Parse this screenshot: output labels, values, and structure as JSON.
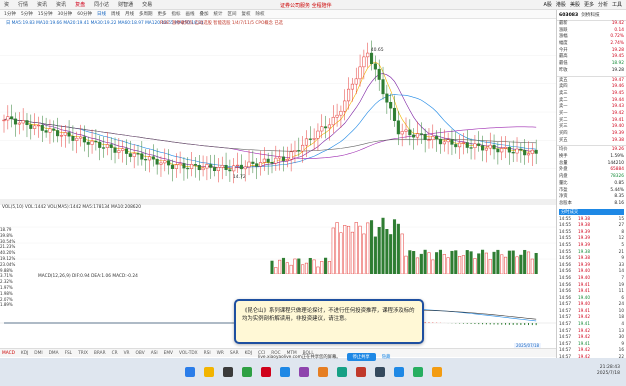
{
  "menu": {
    "items": [
      "资",
      "行情",
      "资讯",
      "资讯",
      "复盘",
      "同小达",
      "财智通",
      "交易"
    ],
    "active": 4,
    "title": "证券公司服务 全程陪伴",
    "right": [
      "A股",
      "港股",
      "美股",
      "更多",
      "分析",
      "工具"
    ]
  },
  "toolbar": {
    "items": [
      "1分钟",
      "5分钟",
      "15分钟",
      "30分钟",
      "60分钟",
      "日线",
      "周线",
      "月线",
      "多周期",
      "更多",
      "指标",
      "画线",
      "叠加",
      "统计",
      "区间",
      "复权",
      "除权"
    ],
    "active": 5
  },
  "ma_info": "日 MA5:19.83 MA10:19.66 MA20:19.41 MA30:19.22 MA60:18.97 MA120:18.55 MA250:18.31",
  "ma_info2": "ROE: 涨停敢死队 自动选股 智能选股 1/4/7/11/5 CPO概念 已选",
  "chart_peak_label": "40.65",
  "chart_low_label": "14.72",
  "vol_label": "VOL(5,10) VOL:1442 VOL(MA5):1442 MA5:178134 MA10:208620",
  "macd_label": "MACD(12,26,9) DIF:0.94 DEA:1.06 MACD:-0.24",
  "left_scale": [
    "18.79",
    "39.8%",
    "30.54%",
    "21.23%",
    "40.20%",
    "19.12%",
    "23.04%",
    "9.88%",
    "3.71%",
    "2.32%",
    "1.97%",
    "1.98%",
    "2.07%",
    "1.89%"
  ],
  "bottom_tabs": [
    "MACD",
    "KDJ",
    "DMI",
    "DMA",
    "FSL",
    "TRIX",
    "BRAR",
    "CR",
    "VR",
    "OBV",
    "ASI",
    "EMV",
    "VOL-TDX",
    "RSI",
    "WR",
    "SAR",
    "KDJ",
    "CCI",
    "ROC",
    "MTM",
    "BOLL"
  ],
  "active_tab": 0,
  "date_mark": "2025/07/18",
  "share": {
    "domain": "live.xiaoyaolive.com正在共享您的屏幕。",
    "stop": "停止共享",
    "hide": "隐藏"
  },
  "subtitle": "《昆仑山》系列课程只做理论探讨，不进行任何投资推荐，课程涉及标的均为实例剖析解读用，非投资建议，请注意。",
  "clock": {
    "time": "21:28:43",
    "date": "2025/7/18"
  },
  "panel": {
    "code": "603083",
    "name": "剑桥科技",
    "rows": [
      {
        "l": "最新",
        "v": "19.42",
        "c": "r"
      },
      {
        "l": "涨跌",
        "v": "0.14",
        "c": "r"
      },
      {
        "l": "涨幅",
        "v": "0.72%",
        "c": "r"
      },
      {
        "l": "幅度",
        "v": "2.74%",
        "c": "r"
      },
      {
        "l": "今开",
        "v": "19.28",
        "c": "r"
      },
      {
        "l": "最高",
        "v": "19.45",
        "c": "r"
      },
      {
        "l": "最低",
        "v": "18.92",
        "c": "g"
      },
      {
        "l": "昨收",
        "v": "19.28",
        "c": "k"
      },
      {
        "l": "卖五",
        "v": "19.47",
        "c": "r"
      },
      {
        "l": "卖四",
        "v": "19.46",
        "c": "r"
      },
      {
        "l": "卖三",
        "v": "19.45",
        "c": "r"
      },
      {
        "l": "卖二",
        "v": "19.44",
        "c": "r"
      },
      {
        "l": "卖一",
        "v": "19.43",
        "c": "r"
      },
      {
        "l": "买一",
        "v": "19.42",
        "c": "r"
      },
      {
        "l": "买二",
        "v": "19.41",
        "c": "r"
      },
      {
        "l": "买三",
        "v": "19.40",
        "c": "r"
      },
      {
        "l": "买四",
        "v": "19.39",
        "c": "r"
      },
      {
        "l": "买五",
        "v": "19.38",
        "c": "r"
      },
      {
        "l": "均价",
        "v": "19.26",
        "c": "r"
      },
      {
        "l": "换手",
        "v": "1.59%",
        "c": "k"
      },
      {
        "l": "总量",
        "v": "144210",
        "c": "k"
      },
      {
        "l": "外盘",
        "v": "65884",
        "c": "r"
      },
      {
        "l": "内盘",
        "v": "78326",
        "c": "g"
      },
      {
        "l": "量比",
        "v": "0.85",
        "c": "k"
      },
      {
        "l": "市盈",
        "v": "5.44%",
        "c": "k"
      },
      {
        "l": "净资",
        "v": "8.35",
        "c": "k"
      },
      {
        "l": "总股本",
        "v": "8.16",
        "c": "k"
      }
    ],
    "status_btn": "分时成交",
    "trades": [
      [
        "14:55",
        "19.38",
        "15"
      ],
      [
        "14:55",
        "19.38",
        "27"
      ],
      [
        "14:55",
        "19.39",
        "8"
      ],
      [
        "14:55",
        "19.39",
        "12"
      ],
      [
        "14:55",
        "19.39",
        "5"
      ],
      [
        "14:55",
        "19.38",
        "21"
      ],
      [
        "14:56",
        "19.38",
        "9"
      ],
      [
        "14:56",
        "19.39",
        "33"
      ],
      [
        "14:56",
        "19.40",
        "14"
      ],
      [
        "14:56",
        "19.40",
        "7"
      ],
      [
        "14:56",
        "19.41",
        "19"
      ],
      [
        "14:56",
        "19.41",
        "11"
      ],
      [
        "14:56",
        "19.40",
        "6"
      ],
      [
        "14:57",
        "19.40",
        "24"
      ],
      [
        "14:57",
        "19.41",
        "10"
      ],
      [
        "14:57",
        "19.42",
        "18"
      ],
      [
        "14:57",
        "19.41",
        "4"
      ],
      [
        "14:57",
        "19.42",
        "13"
      ],
      [
        "14:57",
        "19.42",
        "30"
      ],
      [
        "14:57",
        "19.41",
        "9"
      ],
      [
        "14:57",
        "19.42",
        "16"
      ],
      [
        "14:57",
        "19.42",
        "22"
      ],
      [
        "14:57",
        "19.42",
        "8"
      ],
      [
        "14:57",
        "19.42",
        "12"
      ],
      [
        "14:57",
        "19.42",
        "40"
      ],
      [
        "14:57",
        "19.42",
        "6"
      ],
      [
        "14:57",
        "19.42",
        "27"
      ],
      [
        "15:00",
        "19.42",
        "392"
      ]
    ]
  }
}
